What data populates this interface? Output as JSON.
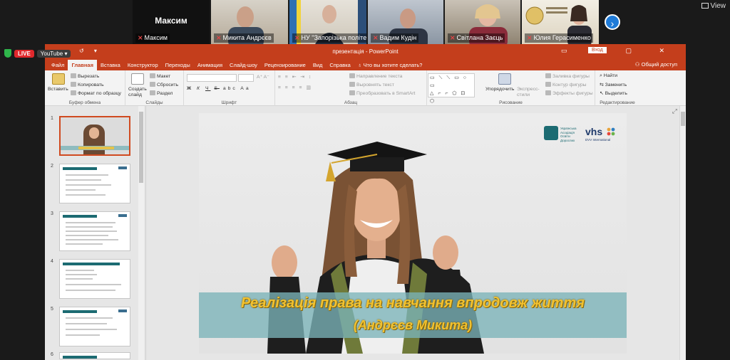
{
  "participants": [
    {
      "name": "Максим",
      "center_label": "Максим"
    },
    {
      "name": "Микита Андрєєв"
    },
    {
      "name": "НУ \"Запорізька політе..."
    },
    {
      "name": "Вадим Кудін"
    },
    {
      "name": "Світлана Заєць"
    },
    {
      "name": "Юлия Герасименко"
    }
  ],
  "zoom": {
    "view_label": "View",
    "next_icon": "chevron-right-icon"
  },
  "stream": {
    "live_label": "LIVE",
    "platform_label": "YouTube"
  },
  "ppt": {
    "title": "презентація - PowerPoint",
    "signin_label": "Вход",
    "share_label": "Общий доступ",
    "tabs": [
      "Файл",
      "Главная",
      "Вставка",
      "Конструктор",
      "Переходы",
      "Анимация",
      "Слайд-шоу",
      "Рецензирование",
      "Вид",
      "Справка",
      "Что вы хотите сделать?"
    ],
    "active_tab": "Главная",
    "ribbon": {
      "clipboard": {
        "paste": "Вставить",
        "cut": "Вырезать",
        "copy": "Копировать",
        "format_painter": "Формат по образцу",
        "label": "Буфер обмена"
      },
      "slides": {
        "create": "Создать слайд",
        "layout": "Макет",
        "reset": "Сбросить",
        "section": "Раздел",
        "label": "Слайды"
      },
      "font": {
        "label": "Шрифт",
        "bold": "Ж",
        "italic": "К",
        "underline": "Ч",
        "strike": "S",
        "spacing": "abc",
        "size_up": "Aa"
      },
      "paragraph": {
        "direction": "Направление текста",
        "align": "Выровнять текст",
        "smartart": "Преобразовать в SmartArt",
        "label": "Абзац"
      },
      "drawing": {
        "arrange": "Упорядочить",
        "quick_styles": "Экспресс-стили",
        "fill": "Заливка фигуры",
        "outline": "Контур фигуры",
        "effects": "Эффекты фигуры",
        "label": "Рисование"
      },
      "editing": {
        "find": "Найти",
        "replace": "Заменить",
        "select": "Выделить",
        "label": "Редактирование"
      }
    },
    "thumb_numbers": [
      "1",
      "2",
      "3",
      "4",
      "5",
      "6"
    ],
    "slide": {
      "title": "Реалізація права на навчання впродовж життя",
      "subtitle": "(Андрєєв Микита)",
      "logo_left": "Українська Асоціація Освіти Дорослих",
      "logo_right": "vhs",
      "logo_right_sub": "DVV International"
    }
  }
}
